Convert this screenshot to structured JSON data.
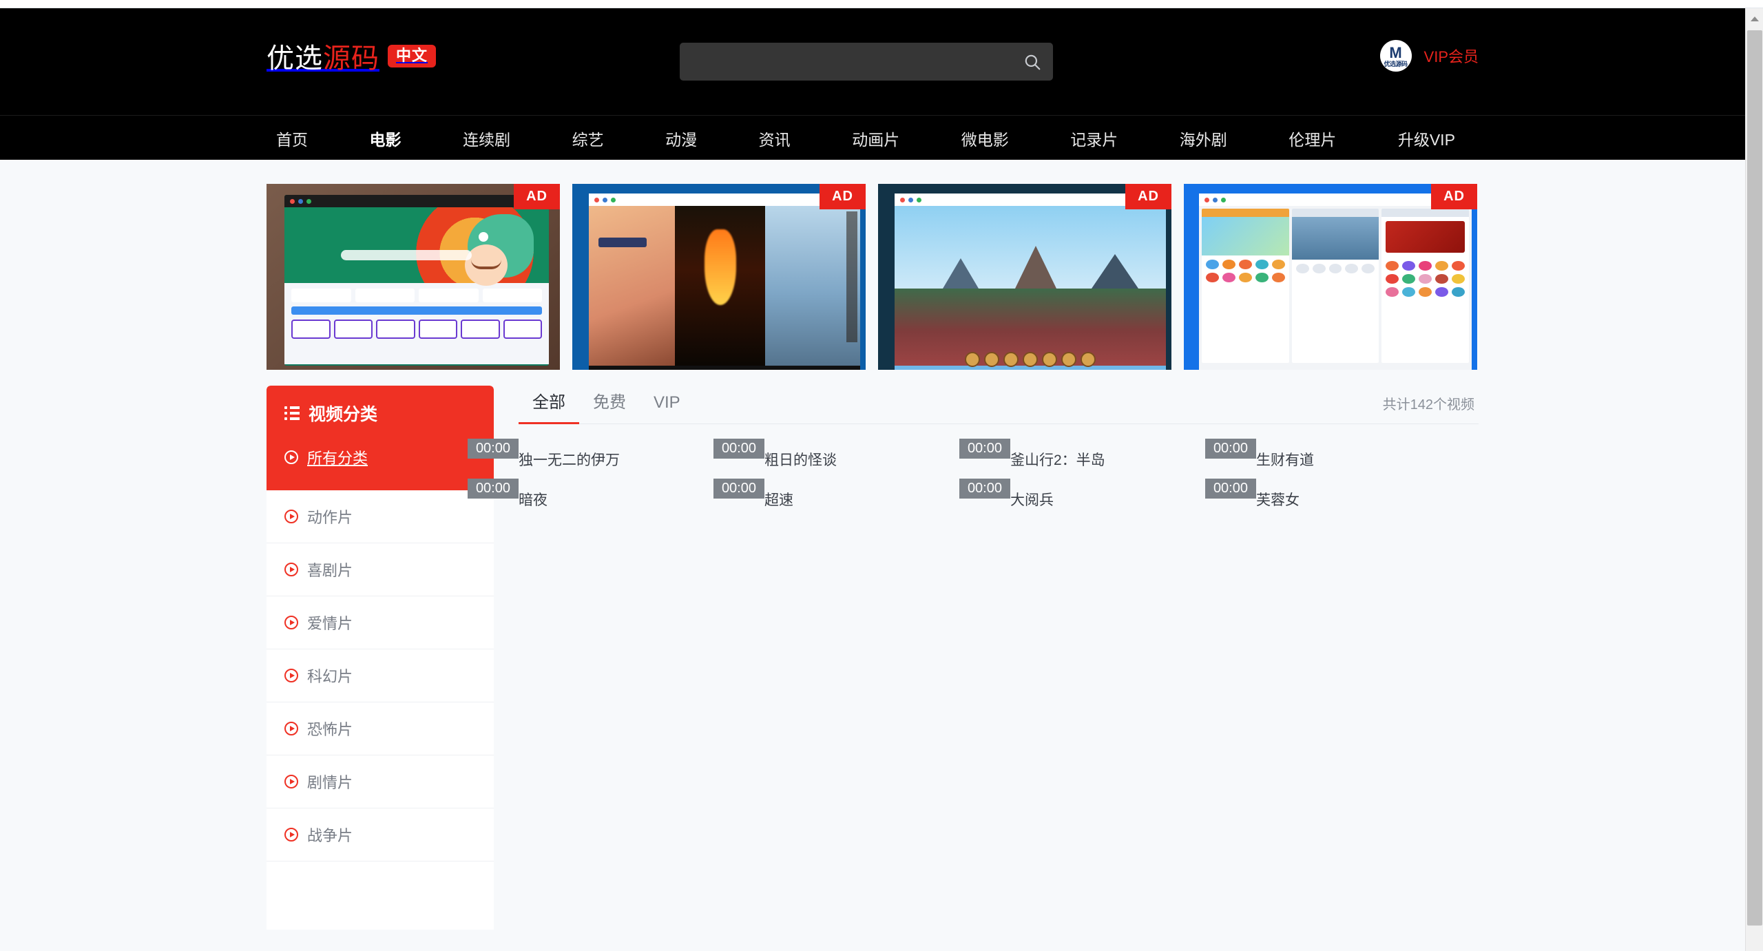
{
  "header": {
    "logo": {
      "part_white": "优选",
      "part_red": "源码",
      "badge": "中文"
    },
    "search": {
      "value": "",
      "placeholder": "",
      "icon": "search-icon"
    },
    "user": {
      "avatar_mark": "M",
      "avatar_text": "优选源码",
      "vip_label": "VIP会员"
    }
  },
  "nav": {
    "items": [
      {
        "label": "首页",
        "active": false
      },
      {
        "label": "电影",
        "active": true
      },
      {
        "label": "连续剧",
        "active": false
      },
      {
        "label": "综艺",
        "active": false
      },
      {
        "label": "动漫",
        "active": false
      },
      {
        "label": "资讯",
        "active": false
      },
      {
        "label": "动画片",
        "active": false
      },
      {
        "label": "微电影",
        "active": false
      },
      {
        "label": "记录片",
        "active": false
      },
      {
        "label": "海外剧",
        "active": false
      },
      {
        "label": "伦理片",
        "active": false
      },
      {
        "label": "升级VIP",
        "active": false
      }
    ]
  },
  "ads": [
    {
      "badge": "AD",
      "name": "dragon-portal-ad"
    },
    {
      "badge": "AD",
      "name": "anime-game-ad"
    },
    {
      "badge": "AD",
      "name": "chinese-game-ad"
    },
    {
      "badge": "AD",
      "name": "mobile-app-ad"
    }
  ],
  "sidebar": {
    "title": "视频分类",
    "title_icon": "list-icon",
    "active_item": {
      "label": "所有分类",
      "icon": "play-circle-icon"
    },
    "items": [
      {
        "label": "动作片",
        "icon": "play-circle-icon"
      },
      {
        "label": "喜剧片",
        "icon": "play-circle-icon"
      },
      {
        "label": "爱情片",
        "icon": "play-circle-icon"
      },
      {
        "label": "科幻片",
        "icon": "play-circle-icon"
      },
      {
        "label": "恐怖片",
        "icon": "play-circle-icon"
      },
      {
        "label": "剧情片",
        "icon": "play-circle-icon"
      },
      {
        "label": "战争片",
        "icon": "play-circle-icon"
      }
    ]
  },
  "main": {
    "tabs": [
      {
        "label": "全部",
        "active": true
      },
      {
        "label": "免费",
        "active": false
      },
      {
        "label": "VIP",
        "active": false
      }
    ],
    "count_text": "共计142个视频",
    "videos": [
      {
        "title": "独一无二的伊万",
        "duration": "00:00"
      },
      {
        "title": "粗日的怪谈",
        "duration": "00:00"
      },
      {
        "title": "釜山行2：半岛",
        "duration": "00:00"
      },
      {
        "title": "生财有道",
        "duration": "00:00"
      },
      {
        "title": "暗夜",
        "duration": "00:00"
      },
      {
        "title": "超速",
        "duration": "00:00"
      },
      {
        "title": "大阅兵",
        "duration": "00:00"
      },
      {
        "title": "芙蓉女",
        "duration": "00:00"
      },
      {
        "title": "",
        "duration": ""
      },
      {
        "title": "",
        "duration": ""
      },
      {
        "title": "",
        "duration": ""
      },
      {
        "title": "",
        "duration": ""
      }
    ]
  },
  "colors": {
    "brand_red": "#ef3124",
    "logo_red": "#e8231c",
    "header_bg": "#000000",
    "page_bg": "#f7f9fb",
    "thumb_gray": "#ced3da"
  }
}
